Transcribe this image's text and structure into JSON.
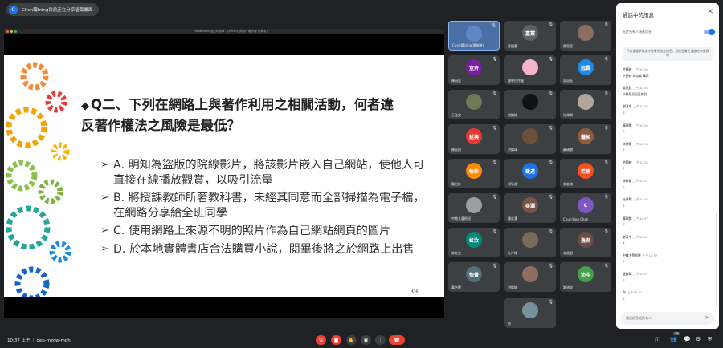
{
  "presenter": {
    "name": "Chen鐵Ining目前正在分享螢幕畫面",
    "avatar_letter": "C"
  },
  "share": {
    "window_title": "PowerPoint 投影片放映 - [109年中央銀行 著作權 法期末]",
    "slide": {
      "question_line1": "Q二、下列在網路上與著作利用之相關活動，何者違",
      "question_line2": "反著作權法之風險是最低？",
      "options": [
        "A. 明知為盜版的院線影片，將該影片嵌入自己網站，使他人可直接在線播放觀賞，以吸引流量",
        "B. 將授課教師所著教科書，未經其同意而全部掃描為電子檔，在網路分享給全班同學",
        "C. 使用網路上來源不明的照片作為自己網站網頁的圖片",
        "D. 於本地實體書店合法購買小說，閱畢後將之於網路上出售"
      ],
      "page_number": "39"
    }
  },
  "participants": [
    {
      "name": "Chen鐵Ining(簡報者)",
      "avatar": "",
      "color": "#5f86c5",
      "active": true
    },
    {
      "name": "廖國曹",
      "avatar": "嘉蕙",
      "color": "#5f6368"
    },
    {
      "name": "戴寫容",
      "avatar": "",
      "color": "#8d6e63"
    },
    {
      "name": "陳冠丞",
      "avatar": "宣卉",
      "color": "#7b1fa2"
    },
    {
      "name": "盧學白作蛋",
      "avatar": "",
      "color": "#f5b4c8"
    },
    {
      "name": "吳冠廷",
      "avatar": "冠霖",
      "color": "#1e88e5"
    },
    {
      "name": "王泓安",
      "avatar": "",
      "color": "#6d7a55"
    },
    {
      "name": "劉錦綸",
      "avatar": "",
      "color": "#111111"
    },
    {
      "name": "杜偉剛",
      "avatar": "",
      "color": "#b0a79a"
    },
    {
      "name": "陳廷錡",
      "avatar": "延興",
      "color": "#e53935"
    },
    {
      "name": "洪錦瑋",
      "avatar": "",
      "color": "#6b4f3a"
    },
    {
      "name": "蘇碩閔",
      "avatar": "瓏昶",
      "color": "#8e5a42"
    },
    {
      "name": "羅怡妙",
      "avatar": "怡妙",
      "color": "#fb8c00"
    },
    {
      "name": "郭致遠",
      "avatar": "致遠",
      "color": "#1a73e8"
    },
    {
      "name": "林若楠",
      "avatar": "若楠",
      "color": "#f4511e"
    },
    {
      "name": "中教大藝術班",
      "avatar": "",
      "color": "#9e9e9e"
    },
    {
      "name": "陳奕瀾",
      "avatar": "奕瀾",
      "color": "#795548"
    },
    {
      "name": "Chun-Ying Chen",
      "avatar": "C",
      "color": "#7e57c2"
    },
    {
      "name": "林虹汝",
      "avatar": "虹汝",
      "color": "#00897b"
    },
    {
      "name": "杜仲緒",
      "avatar": "",
      "color": "#7a6a5a"
    },
    {
      "name": "林逸君",
      "avatar": "逸君",
      "color": "#6d4c41"
    },
    {
      "name": "黃怡菁",
      "avatar": "怡菁",
      "color": "#546e7a"
    },
    {
      "name": "洪錦婷",
      "avatar": "",
      "color": "#8d6e63"
    },
    {
      "name": "謝沛岑",
      "avatar": "沛岑",
      "color": "#43a047"
    },
    {
      "name": "你",
      "avatar": "",
      "color": "#78909c"
    }
  ],
  "chat": {
    "title": "通話中的訊息",
    "toggle_label": "允許所有人傳送訊息",
    "notice": "只有通話參與者才能看到這些訊息，且訊息會在通話結束後刪除",
    "messages": [
      {
        "who": "洪錦婷",
        "time": "上午10:33",
        "text": "洪錦婷 郭育紫 萬苡"
      },
      {
        "who": "吳冠廷",
        "time": "上午10:34",
        "text": "科教系吳冠廷報到"
      },
      {
        "who": "劉浮中",
        "time": "上午10:35",
        "text": "0"
      },
      {
        "who": "蘇碩閔",
        "time": "上午10:35",
        "text": "0"
      },
      {
        "who": "林禎爾",
        "time": "上午10:35",
        "text": "0"
      },
      {
        "who": "洪錦婷",
        "time": "上午10:35",
        "text": "0"
      },
      {
        "who": "林禎爾",
        "time": "上午10:37",
        "text": "0"
      },
      {
        "who": "杜偉剛",
        "time": "上午10:37",
        "text": "0"
      },
      {
        "who": "蘇碩閔",
        "time": "上午10:37",
        "text": "0"
      },
      {
        "who": "劉浮中",
        "time": "上午10:37",
        "text": "d"
      },
      {
        "who": "中教大藝術班",
        "time": "上午10:37",
        "text": "0"
      },
      {
        "who": "盧路瑋",
        "time": "上午10:37",
        "text": "0"
      },
      {
        "who": "你",
        "time": "上午10:37",
        "text": "0"
      }
    ],
    "input_placeholder": "傳送訊息給所有人"
  },
  "bottom": {
    "time": "10:37 上午",
    "meeting_code": "oeu-mzcw-mgh",
    "people_count": "28"
  }
}
